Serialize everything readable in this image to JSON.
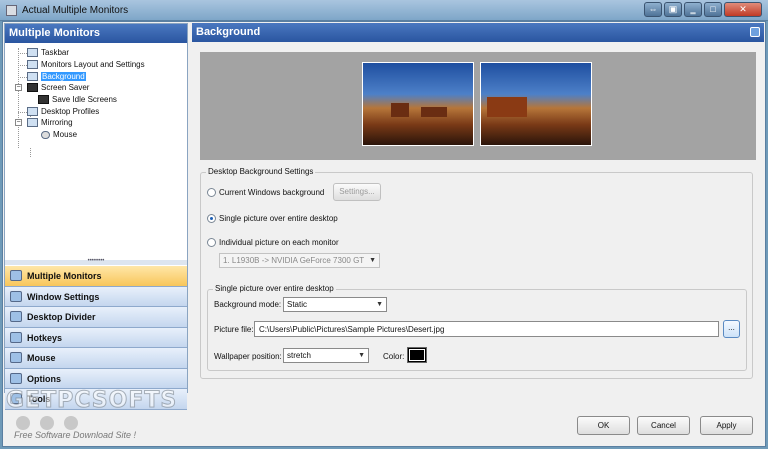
{
  "window": {
    "title": "Actual Multiple Monitors"
  },
  "left_pane": {
    "title": "Multiple Monitors",
    "tree": [
      {
        "label": "Taskbar"
      },
      {
        "label": "Monitors Layout and Settings"
      },
      {
        "label": "Background",
        "selected": true
      },
      {
        "label": "Screen Saver"
      },
      {
        "label": "Save Idle Screens"
      },
      {
        "label": "Desktop Profiles"
      },
      {
        "label": "Mirroring"
      },
      {
        "label": "Mouse"
      }
    ],
    "nav": [
      {
        "label": "Multiple Monitors",
        "active": true
      },
      {
        "label": "Window Settings"
      },
      {
        "label": "Desktop Divider"
      },
      {
        "label": "Hotkeys"
      },
      {
        "label": "Mouse"
      },
      {
        "label": "Options"
      },
      {
        "label": "Tools"
      }
    ]
  },
  "right_pane": {
    "title": "Background",
    "desktop_settings": {
      "group_title": "Desktop Background Settings",
      "opt_current": "Current Windows background",
      "settings_button": "Settings...",
      "opt_single": "Single picture over entire desktop",
      "opt_individual": "Individual picture on each monitor",
      "monitor_combo": "1. L1930B -> NVIDIA GeForce 7300 GT",
      "selected_option": "single"
    },
    "single_picture": {
      "group_title": "Single picture over entire desktop",
      "mode_label": "Background mode:",
      "mode_value": "Static",
      "file_label": "Picture file:",
      "file_value": "C:\\Users\\Public\\Pictures\\Sample Pictures\\Desert.jpg",
      "browse_label": "...",
      "position_label": "Wallpaper position:",
      "position_value": "stretch",
      "color_label": "Color:",
      "color_value": "#000000"
    }
  },
  "buttons": {
    "ok": "OK",
    "cancel": "Cancel",
    "apply": "Apply"
  },
  "watermark": {
    "brand": "GETPCSOFTS",
    "tagline": "Free Software Download Site !"
  }
}
